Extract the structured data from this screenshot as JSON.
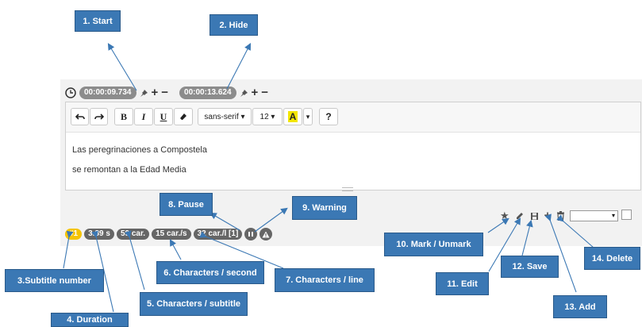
{
  "time_row": {
    "start_time": "00:00:09.734",
    "end_time": "00:00:13.624",
    "plus": "+",
    "minus": "−"
  },
  "toolbar": {
    "undo_icon": "undo-icon",
    "redo_icon": "redo-icon",
    "bold": "B",
    "italic": "I",
    "underline": "U",
    "eraser_icon": "eraser-icon",
    "font_family": "sans-serif ▾",
    "font_size": "12 ▾",
    "text_color": "A",
    "dropdown_arrow": "▾",
    "help": "?",
    "highlight_color": "#f3e600"
  },
  "subtitle_lines": [
    "Las peregrinaciones a Compostela",
    "se remontan a la Edad Media"
  ],
  "status": {
    "number": "#1",
    "duration": "3.89 s",
    "characters": "59 car.",
    "cps": "15 car./s",
    "cpl": "32 car./l [1]",
    "pause_icon": "pause-icon",
    "warning_icon": "warning-icon"
  },
  "actions": {
    "mark": "★",
    "edit_icon": "pencil-icon",
    "save_icon": "save-icon",
    "add": "+",
    "delete_icon": "trash-icon",
    "select_value": "▾"
  },
  "callouts": [
    "1. Start",
    "2. Hide",
    "3.Subtitle number",
    "4. Duration",
    "5. Characters / subtitle",
    "6. Characters / second",
    "7. Characters / line",
    "8. Pause",
    "9. Warning",
    "10. Mark / Unmark",
    "11. Edit",
    "12. Save",
    "13. Add",
    "14. Delete"
  ],
  "colors": {
    "callout_bg": "#3b78b4",
    "badge_gray": "#666666",
    "badge_yellow": "#f5c400"
  }
}
